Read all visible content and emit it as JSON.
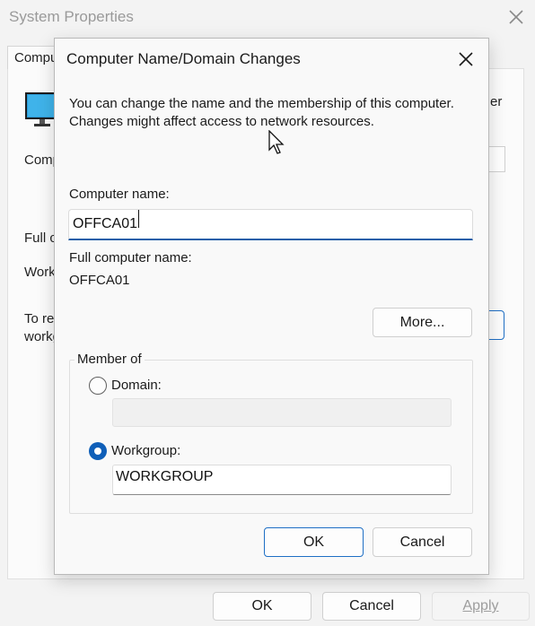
{
  "background": {
    "window_title": "System Properties",
    "tab_label": "Computer Name",
    "computer_description_label": "Computer description:",
    "right_fragment": "er",
    "full_name_label": "Full computer name:",
    "workgroup_label": "Workgroup:",
    "rename_text_line1": "To rename this computer or change its domain or",
    "rename_text_line2": "workgroup, click Change.",
    "buttons": {
      "ok": "OK",
      "cancel": "Cancel",
      "apply": "Apply"
    }
  },
  "dialog": {
    "title": "Computer Name/Domain Changes",
    "description": "You can change the name and the membership of this computer. Changes might affect access to network resources.",
    "computer_name_label": "Computer name:",
    "computer_name_value": "OFFCA01",
    "full_name_label": "Full computer name:",
    "full_name_value": "OFFCA01",
    "more_button": "More...",
    "member_of": {
      "legend": "Member of",
      "domain_label": "Domain:",
      "domain_value": "",
      "workgroup_label": "Workgroup:",
      "workgroup_value": "WORKGROUP",
      "selected": "workgroup"
    },
    "buttons": {
      "ok": "OK",
      "cancel": "Cancel"
    }
  },
  "colors": {
    "accent": "#0f5fb8",
    "input_underline": "#1f5fa8"
  },
  "icons": [
    "close-icon",
    "monitor-icon",
    "mouse-cursor-icon"
  ]
}
